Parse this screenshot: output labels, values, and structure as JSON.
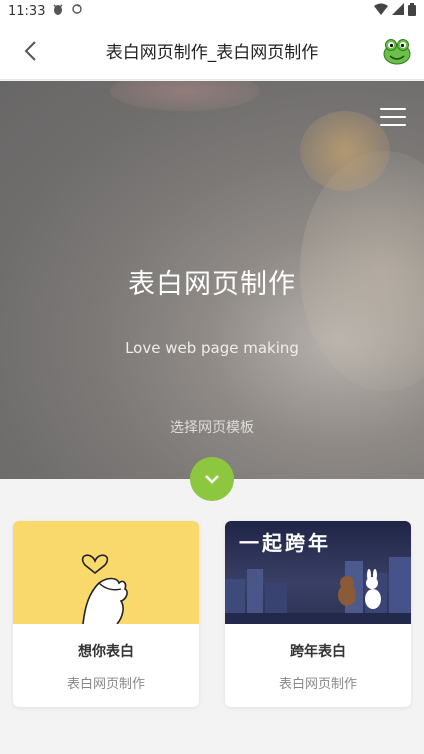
{
  "status": {
    "time": "11:33"
  },
  "header": {
    "title": "表白网页制作_表白网页制作"
  },
  "hero": {
    "title": "表白网页制作",
    "subtitle": "Love web page making",
    "choose_label": "选择网页模板"
  },
  "templates": [
    {
      "title": "想你表白",
      "subtitle": "表白网页制作"
    },
    {
      "title": "跨年表白",
      "subtitle": "表白网页制作",
      "banner_text": "一起跨年"
    }
  ],
  "colors": {
    "accent": "#8dc63f",
    "card_bg_yellow": "#f9d96b",
    "night_bg": "#2a3352"
  }
}
